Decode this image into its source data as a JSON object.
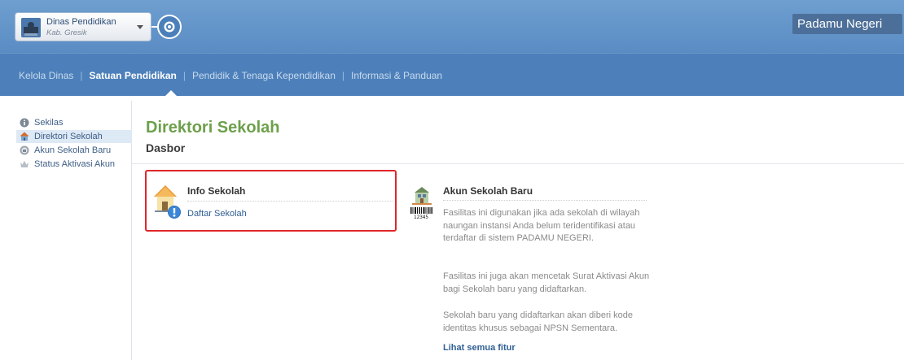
{
  "header": {
    "account_name": "Dinas Pendidikan",
    "account_region": "Kab. Gresik",
    "brand": "Padamu Negeri"
  },
  "topnav": {
    "items": [
      {
        "label": "Kelola Dinas",
        "active": false
      },
      {
        "label": "Satuan Pendidikan",
        "active": true
      },
      {
        "label": "Pendidik & Tenaga Kependidikan",
        "active": false
      },
      {
        "label": "Informasi & Panduan",
        "active": false
      }
    ]
  },
  "sidebar": {
    "items": [
      {
        "label": "Sekilas",
        "icon": "info-icon"
      },
      {
        "label": "Direktori Sekolah",
        "icon": "school-house-icon",
        "active": true
      },
      {
        "label": "Akun Sekolah Baru",
        "icon": "new-school-icon"
      },
      {
        "label": "Status Aktivasi Akun",
        "icon": "status-crown-icon"
      }
    ]
  },
  "main": {
    "title": "Direktori Sekolah",
    "subtitle": "Dasbor",
    "card_info": {
      "title": "Info Sekolah",
      "link": "Daftar Sekolah",
      "icon": "school-info-icon"
    },
    "card_new": {
      "title": "Akun Sekolah Baru",
      "icon": "school-barcode-icon",
      "icon_caption": "12345",
      "p1": "Fasilitas ini digunakan jika ada sekolah di wilayah naungan instansi Anda belum teridentifikasi atau terdaftar di sistem PADAMU NEGERI.",
      "p2": "Fasilitas ini juga akan mencetak Surat Aktivasi Akun bagi Sekolah baru yang didaftarkan.",
      "p3": "Sekolah baru yang didaftarkan akan diberi kode identitas khusus sebagai NPSN Sementara.",
      "see_all": "Lihat semua fitur"
    }
  },
  "colors": {
    "header": "#5a8cc4",
    "nav": "#4d80ba",
    "title_green": "#6da04b",
    "highlight_red": "#e0262a",
    "link_blue": "#2f5f94"
  }
}
